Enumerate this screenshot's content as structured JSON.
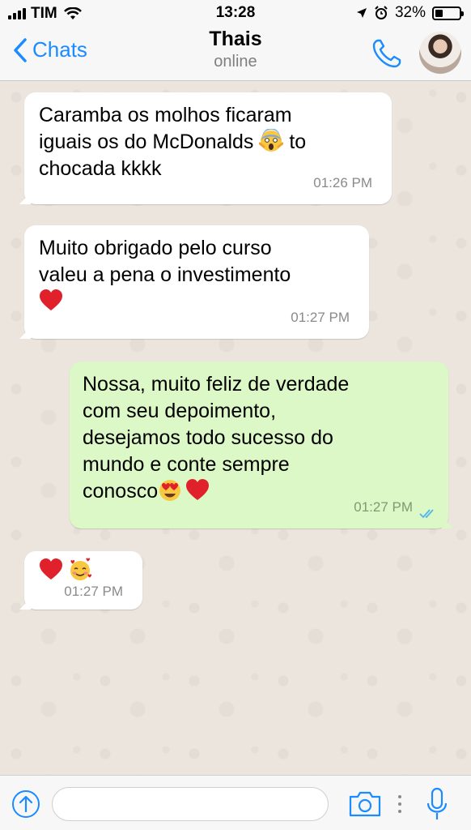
{
  "status_bar": {
    "carrier": "TIM",
    "time": "13:28",
    "battery": "32%",
    "battery_level": 0.32,
    "icons": [
      "signal-icon",
      "wifi-icon",
      "location-icon",
      "alarm-icon",
      "battery-icon"
    ]
  },
  "header": {
    "back_label": "Chats",
    "contact_name": "Thais",
    "status": "online",
    "icons": [
      "back-chevron-icon",
      "phone-icon",
      "avatar"
    ]
  },
  "messages": [
    {
      "direction": "incoming",
      "lines": [
        "Caramba os molhos ficaram",
        "iguais os do McDonalds",
        "chocada kkkk"
      ],
      "inline_after_line2": "to",
      "emoji": [
        "screaming-face-emoji"
      ],
      "time": "01:26 PM"
    },
    {
      "direction": "incoming",
      "lines": [
        "Muito obrigado pelo curso",
        "valeu a pena o investimento"
      ],
      "emoji": [
        "red-heart-emoji"
      ],
      "time": "01:27 PM"
    },
    {
      "direction": "outgoing",
      "lines": [
        "Nossa, muito feliz de verdade",
        "com seu depoimento,",
        "desejamos todo sucesso do",
        "mundo e conte sempre",
        "conosco"
      ],
      "emoji": [
        "heart-eyes-emoji",
        "red-heart-emoji"
      ],
      "time": "01:27 PM",
      "read_receipt": "double-check-icon"
    },
    {
      "direction": "incoming",
      "lines": [],
      "emoji": [
        "red-heart-emoji",
        "smiling-face-with-hearts-emoji"
      ],
      "time": "01:27 PM"
    }
  ],
  "composer": {
    "placeholder": "",
    "value": "",
    "icons": [
      "upload-icon",
      "camera-icon",
      "more-dots-icon",
      "microphone-icon"
    ]
  },
  "colors": {
    "accent": "#1a8cff",
    "incoming_bubble": "#ffffff",
    "outgoing_bubble": "#dcf8c6",
    "chat_background": "#ece5dd",
    "read_tick": "#4fb6ec"
  }
}
